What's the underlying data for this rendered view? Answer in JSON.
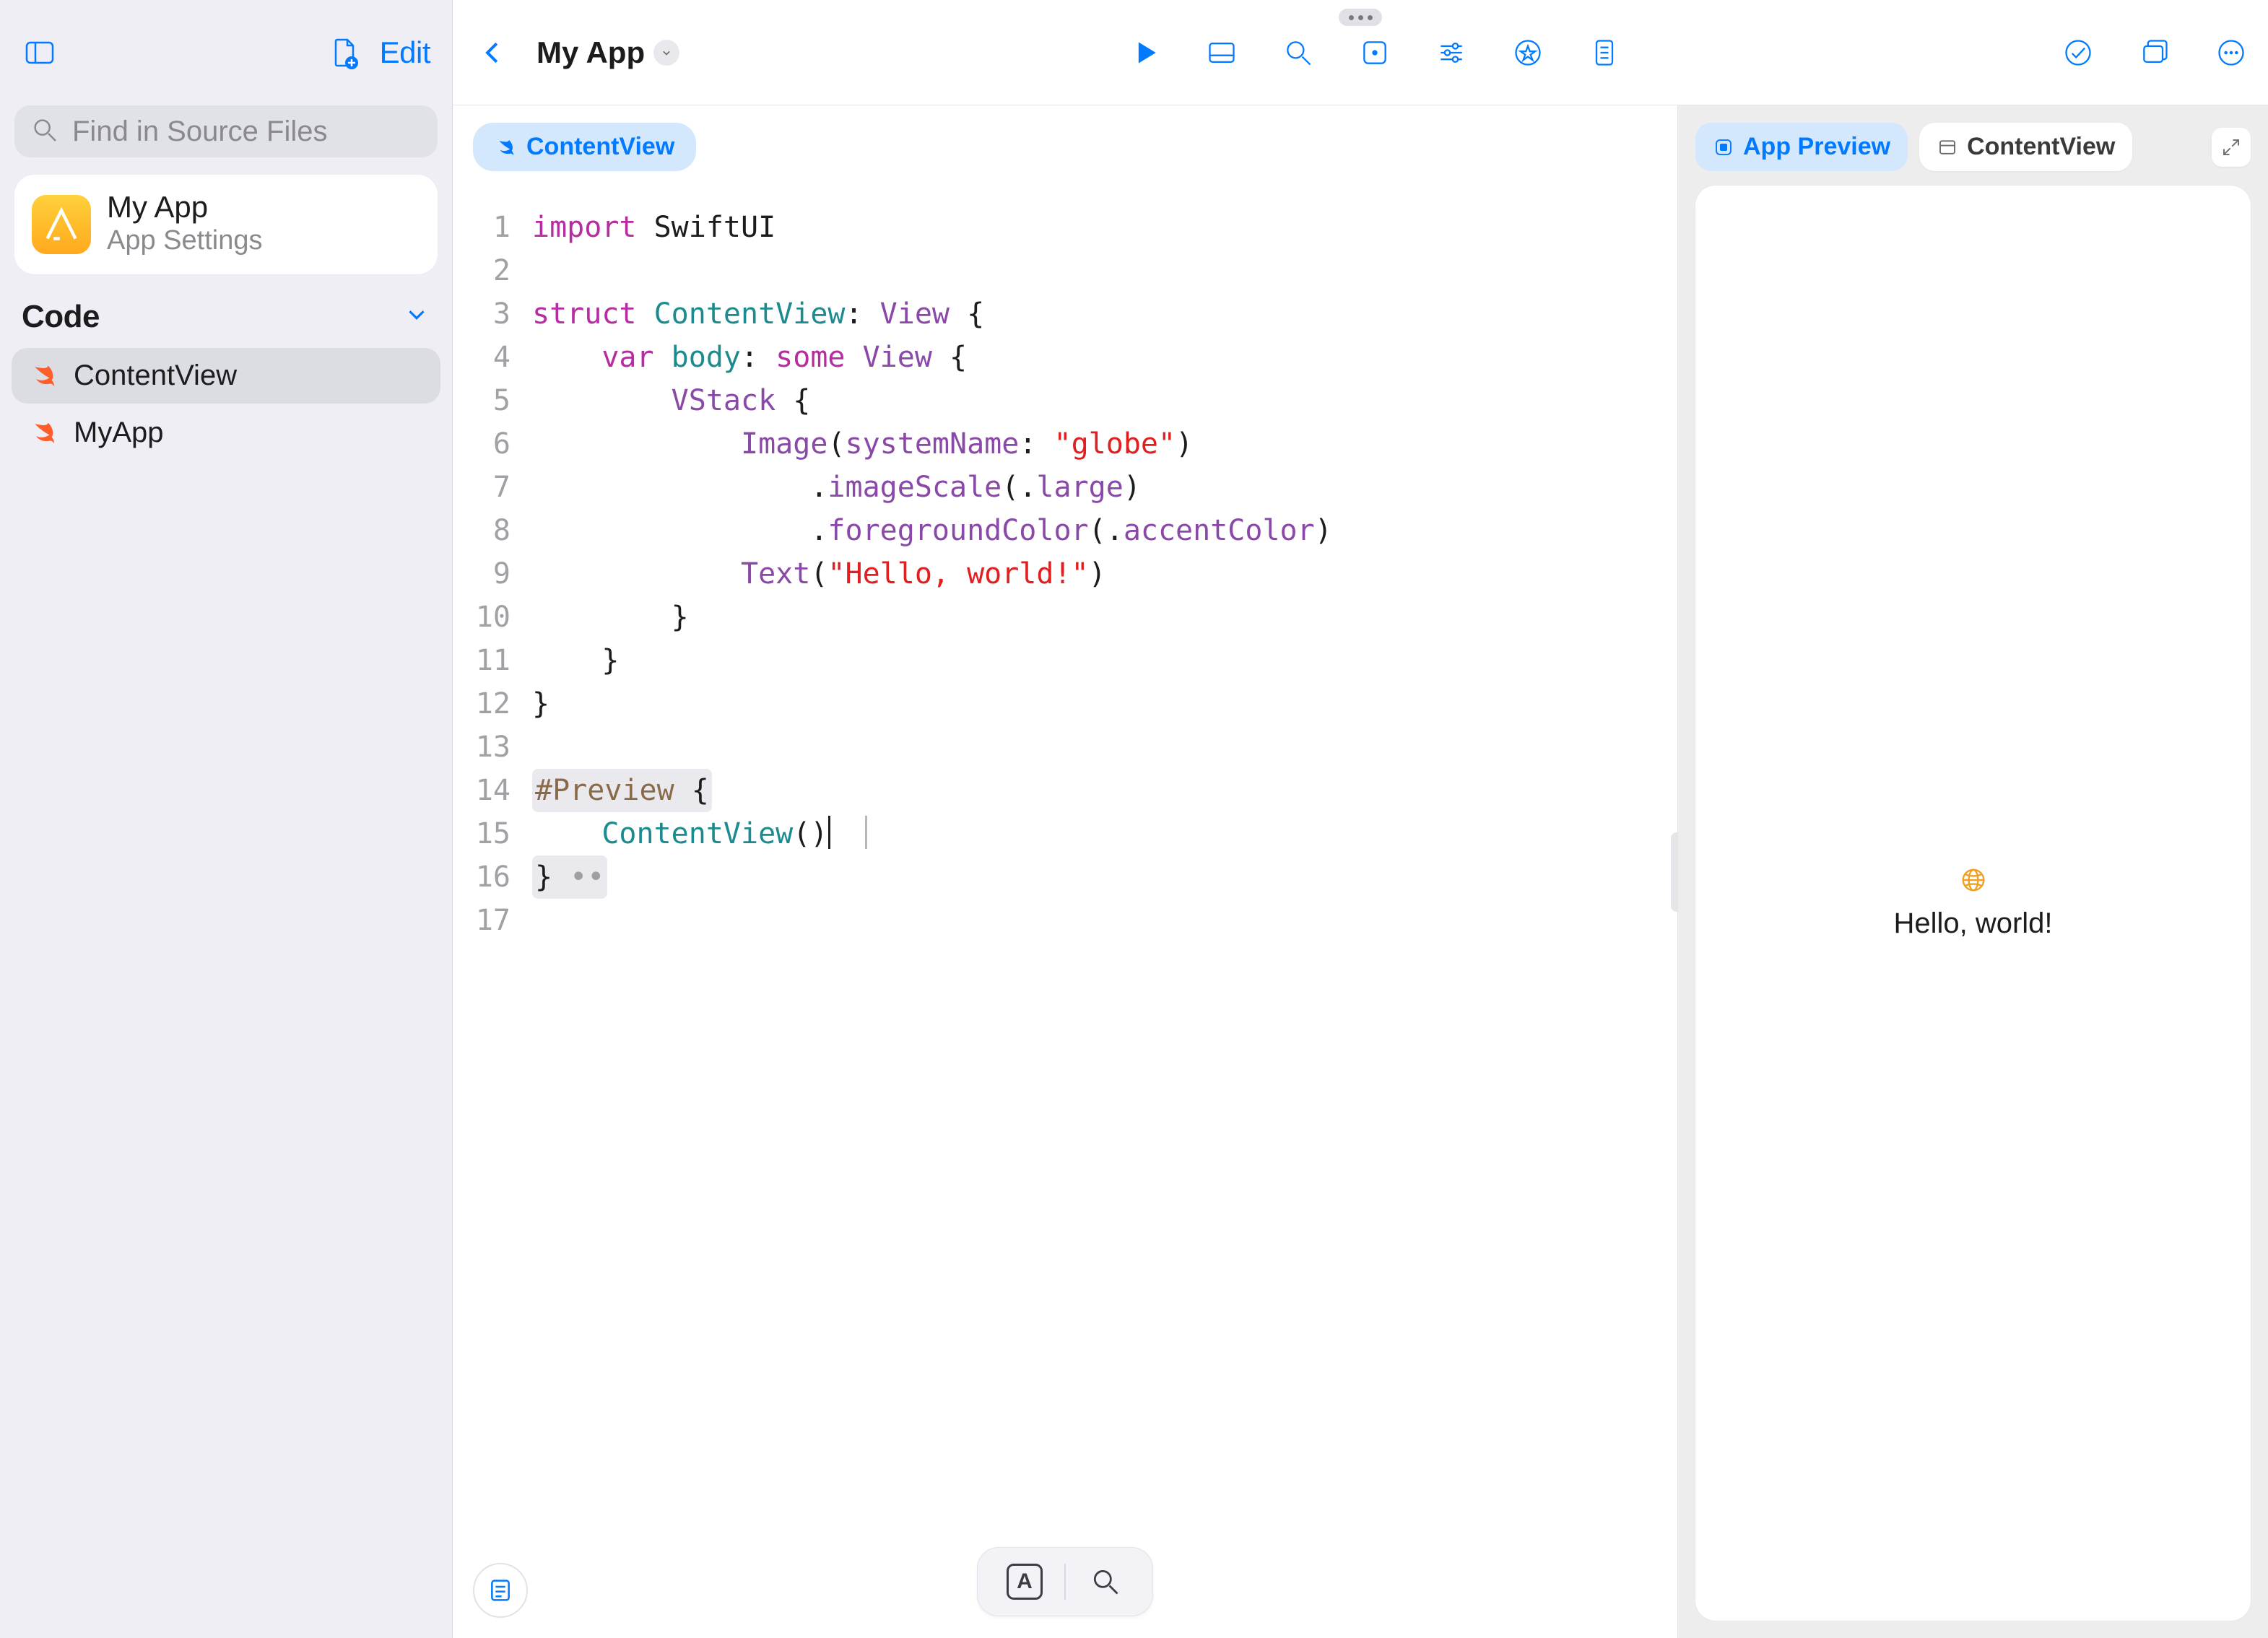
{
  "sidebar": {
    "edit_label": "Edit",
    "search_placeholder": "Find in Source Files",
    "app": {
      "title": "My App",
      "subtitle": "App Settings"
    },
    "section_label": "Code",
    "files": [
      {
        "name": "ContentView",
        "selected": true
      },
      {
        "name": "MyApp",
        "selected": false
      }
    ]
  },
  "toolbar": {
    "app_title": "My App"
  },
  "editor": {
    "open_file_tab": "ContentView",
    "lines": [
      {
        "n": 1,
        "tokens": [
          {
            "t": "import",
            "c": "kw"
          },
          {
            "t": " SwiftUI",
            "c": "plain"
          }
        ]
      },
      {
        "n": 2,
        "tokens": []
      },
      {
        "n": 3,
        "tokens": [
          {
            "t": "struct",
            "c": "kw"
          },
          {
            "t": " ",
            "c": "plain"
          },
          {
            "t": "ContentView",
            "c": "type"
          },
          {
            "t": ": ",
            "c": "plain"
          },
          {
            "t": "View",
            "c": "memb"
          },
          {
            "t": " {",
            "c": "plain"
          }
        ]
      },
      {
        "n": 4,
        "tokens": [
          {
            "t": "    ",
            "c": "plain"
          },
          {
            "t": "var",
            "c": "kw"
          },
          {
            "t": " ",
            "c": "plain"
          },
          {
            "t": "body",
            "c": "type"
          },
          {
            "t": ": ",
            "c": "plain"
          },
          {
            "t": "some",
            "c": "kw"
          },
          {
            "t": " ",
            "c": "plain"
          },
          {
            "t": "View",
            "c": "memb"
          },
          {
            "t": " {",
            "c": "plain"
          }
        ]
      },
      {
        "n": 5,
        "tokens": [
          {
            "t": "        ",
            "c": "plain"
          },
          {
            "t": "VStack",
            "c": "memb"
          },
          {
            "t": " {",
            "c": "plain"
          }
        ]
      },
      {
        "n": 6,
        "tokens": [
          {
            "t": "            ",
            "c": "plain"
          },
          {
            "t": "Image",
            "c": "memb"
          },
          {
            "t": "(",
            "c": "plain"
          },
          {
            "t": "systemName",
            "c": "memb"
          },
          {
            "t": ": ",
            "c": "plain"
          },
          {
            "t": "\"globe\"",
            "c": "str"
          },
          {
            "t": ")",
            "c": "plain"
          }
        ]
      },
      {
        "n": 7,
        "tokens": [
          {
            "t": "                .",
            "c": "plain"
          },
          {
            "t": "imageScale",
            "c": "memb"
          },
          {
            "t": "(.",
            "c": "plain"
          },
          {
            "t": "large",
            "c": "memb"
          },
          {
            "t": ")",
            "c": "plain"
          }
        ]
      },
      {
        "n": 8,
        "tokens": [
          {
            "t": "                .",
            "c": "plain"
          },
          {
            "t": "foregroundColor",
            "c": "memb"
          },
          {
            "t": "(.",
            "c": "plain"
          },
          {
            "t": "accentColor",
            "c": "memb"
          },
          {
            "t": ")",
            "c": "plain"
          }
        ]
      },
      {
        "n": 9,
        "tokens": [
          {
            "t": "            ",
            "c": "plain"
          },
          {
            "t": "Text",
            "c": "memb"
          },
          {
            "t": "(",
            "c": "plain"
          },
          {
            "t": "\"Hello, world!\"",
            "c": "str"
          },
          {
            "t": ")",
            "c": "plain"
          }
        ]
      },
      {
        "n": 10,
        "tokens": [
          {
            "t": "        }",
            "c": "plain"
          }
        ]
      },
      {
        "n": 11,
        "tokens": [
          {
            "t": "    }",
            "c": "plain"
          }
        ]
      },
      {
        "n": 12,
        "tokens": [
          {
            "t": "}",
            "c": "plain"
          }
        ]
      },
      {
        "n": 13,
        "tokens": []
      },
      {
        "n": 14,
        "hl": true,
        "tokens": [
          {
            "t": "#Preview",
            "c": "attr"
          },
          {
            "t": " {",
            "c": "plain"
          }
        ]
      },
      {
        "n": 15,
        "caret": true,
        "extra_caret": true,
        "tokens": [
          {
            "t": "    ",
            "c": "plain"
          },
          {
            "t": "ContentView",
            "c": "type"
          },
          {
            "t": "()",
            "c": "plain"
          }
        ]
      },
      {
        "n": 16,
        "hl": true,
        "fold": true,
        "tokens": [
          {
            "t": "}",
            "c": "plain"
          }
        ]
      },
      {
        "n": 17,
        "tokens": []
      }
    ]
  },
  "preview": {
    "tabs": [
      {
        "label": "App Preview",
        "active": true
      },
      {
        "label": "ContentView",
        "active": false
      }
    ],
    "hello_text": "Hello, world!"
  }
}
